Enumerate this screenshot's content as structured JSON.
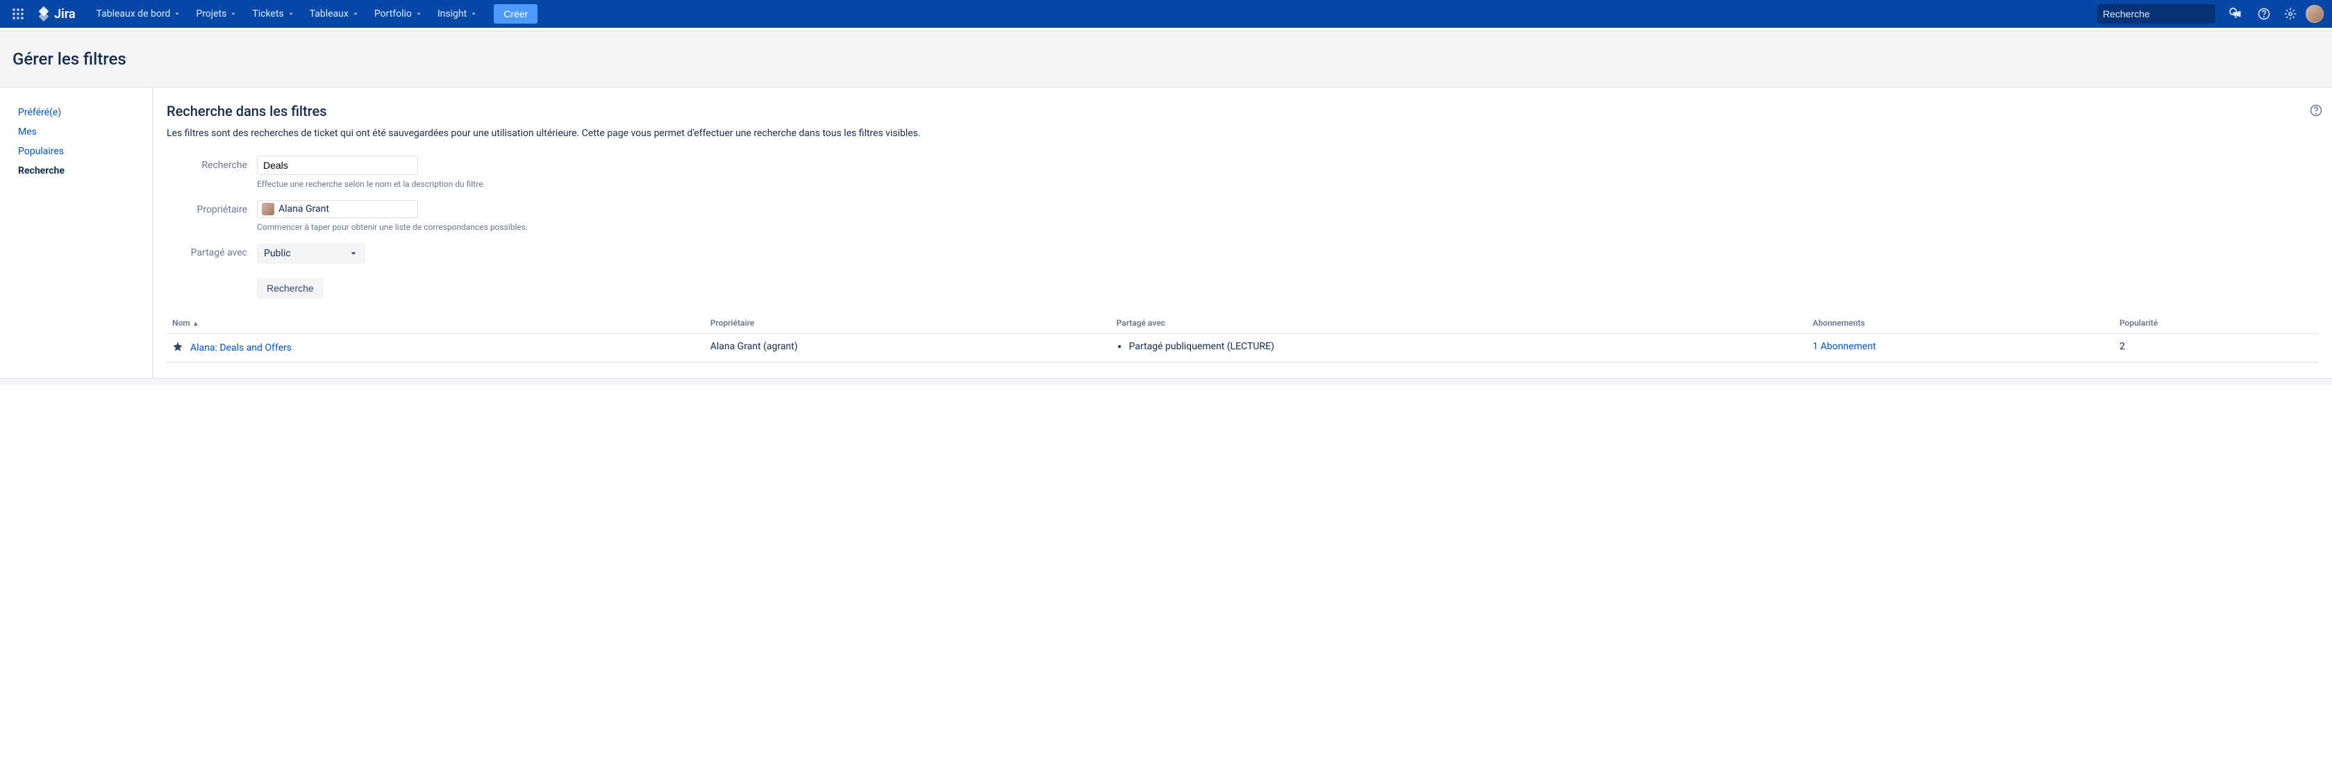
{
  "topnav": {
    "logo_text": "Jira",
    "items": [
      "Tableaux de bord",
      "Projets",
      "Tickets",
      "Tableaux",
      "Portfolio",
      "Insight"
    ],
    "create_label": "Créer",
    "search_placeholder": "Recherche"
  },
  "page": {
    "title": "Gérer les filtres"
  },
  "sidebar": {
    "items": [
      {
        "label": "Préféré(e)",
        "active": false
      },
      {
        "label": "Mes",
        "active": false
      },
      {
        "label": "Populaires",
        "active": false
      },
      {
        "label": "Recherche",
        "active": true
      }
    ]
  },
  "content": {
    "section_title": "Recherche dans les filtres",
    "section_desc": "Les filtres sont des recherches de ticket qui ont été sauvegardées pour une utilisation ultérieure. Cette page vous permet d'effectuer une recherche dans tous les filtres visibles.",
    "form": {
      "search_label": "Recherche",
      "search_value": "Deals",
      "search_hint": "Effectue une recherche selon le nom et la description du filtre.",
      "owner_label": "Propriétaire",
      "owner_value": "Alana Grant",
      "owner_hint": "Commencer à taper pour obtenir une liste de correspondances possibles.",
      "shared_label": "Partagé avec",
      "shared_value": "Public",
      "submit_label": "Recherche"
    },
    "table": {
      "columns": {
        "name": "Nom",
        "owner": "Propriétaire",
        "shared": "Partagé avec",
        "subscriptions": "Abonnements",
        "popularity": "Popularité"
      },
      "rows": [
        {
          "name": "Alana: Deals and Offers",
          "owner": "Alana Grant (agrant)",
          "shared": "Partagé publiquement (LECTURE)",
          "subscriptions": "1 Abonnement",
          "popularity": "2"
        }
      ]
    }
  }
}
